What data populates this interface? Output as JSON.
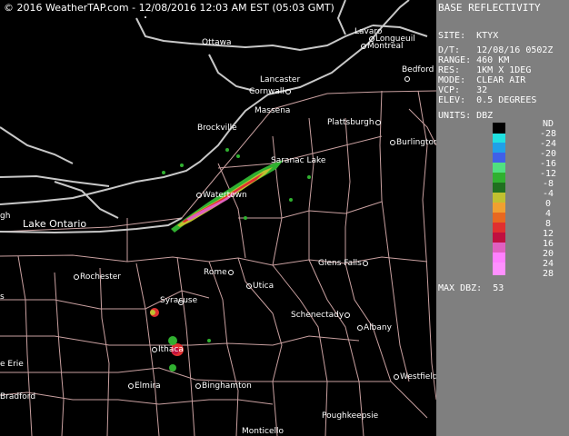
{
  "banner": {
    "text": "© 2016 WeatherTAP.com - 12/08/2016 12:03 AM EST (05:03 GMT)"
  },
  "panel": {
    "title": "BASE REFLECTIVITY",
    "site": "SITE:  KTYX",
    "dt": "D/T:   12/08/16 0502Z",
    "range": "RANGE: 460 KM",
    "res": "RES:   1KM X 1DEG",
    "mode": "MODE:  CLEAR AIR",
    "vcp": "VCP:   32",
    "elev": "ELEV:  0.5 DEGREES",
    "units": "UNITS: DBZ",
    "max": "MAX DBZ:  53"
  },
  "scale": {
    "labels": [
      "ND",
      "-28",
      "-24",
      "-20",
      "-16",
      "-12",
      "-8",
      "-4",
      "0",
      "4",
      "8",
      "12",
      "16",
      "20",
      "24",
      "28"
    ],
    "colors": [
      "#000000",
      "#20e0e0",
      "#20a0e8",
      "#4060e8",
      "#50e080",
      "#30b030",
      "#207020",
      "#c0c030",
      "#f0a030",
      "#e86820",
      "#e03030",
      "#c01040",
      "#e060c0",
      "#ff80ff",
      "#ff90ff"
    ]
  },
  "places": {
    "ottawa": "Ottawa",
    "lavaro": "Lavaro",
    "longueuil": "Longueuil",
    "montreal": "Montreal",
    "bedford": "Bedford",
    "lancaster": "Lancaster",
    "cornwall": "Cornwall",
    "massena": "Massena",
    "plattsburgh": "Plattsburgh",
    "brockville": "Brockville",
    "burlington": "Burlington",
    "saranac": "Saranac Lake",
    "watertown": "Watertown",
    "gh": "gh",
    "rochester": "Rochester",
    "rome": "Rome",
    "utica": "Utica",
    "glens": "Glens Falls",
    "syracuse": "Syracuse",
    "schenectady": "Schenectady",
    "albany": "Albany",
    "ithaca": "Ithaca",
    "erie": "e Erie",
    "elmira": "Elmira",
    "binghamton": "Binghamton",
    "westfield": "Westfield",
    "bradford": "Bradford",
    "poughkeepsie": "Poughkeepsie",
    "monticello": "Monticello",
    "s": "s"
  },
  "lakes": {
    "ontario": "Lake Ontario"
  },
  "colors": {
    "background": "#000000",
    "panel": "#7f7f7f",
    "roads": "#c8c8c8",
    "borders": "#c9a0a0"
  }
}
